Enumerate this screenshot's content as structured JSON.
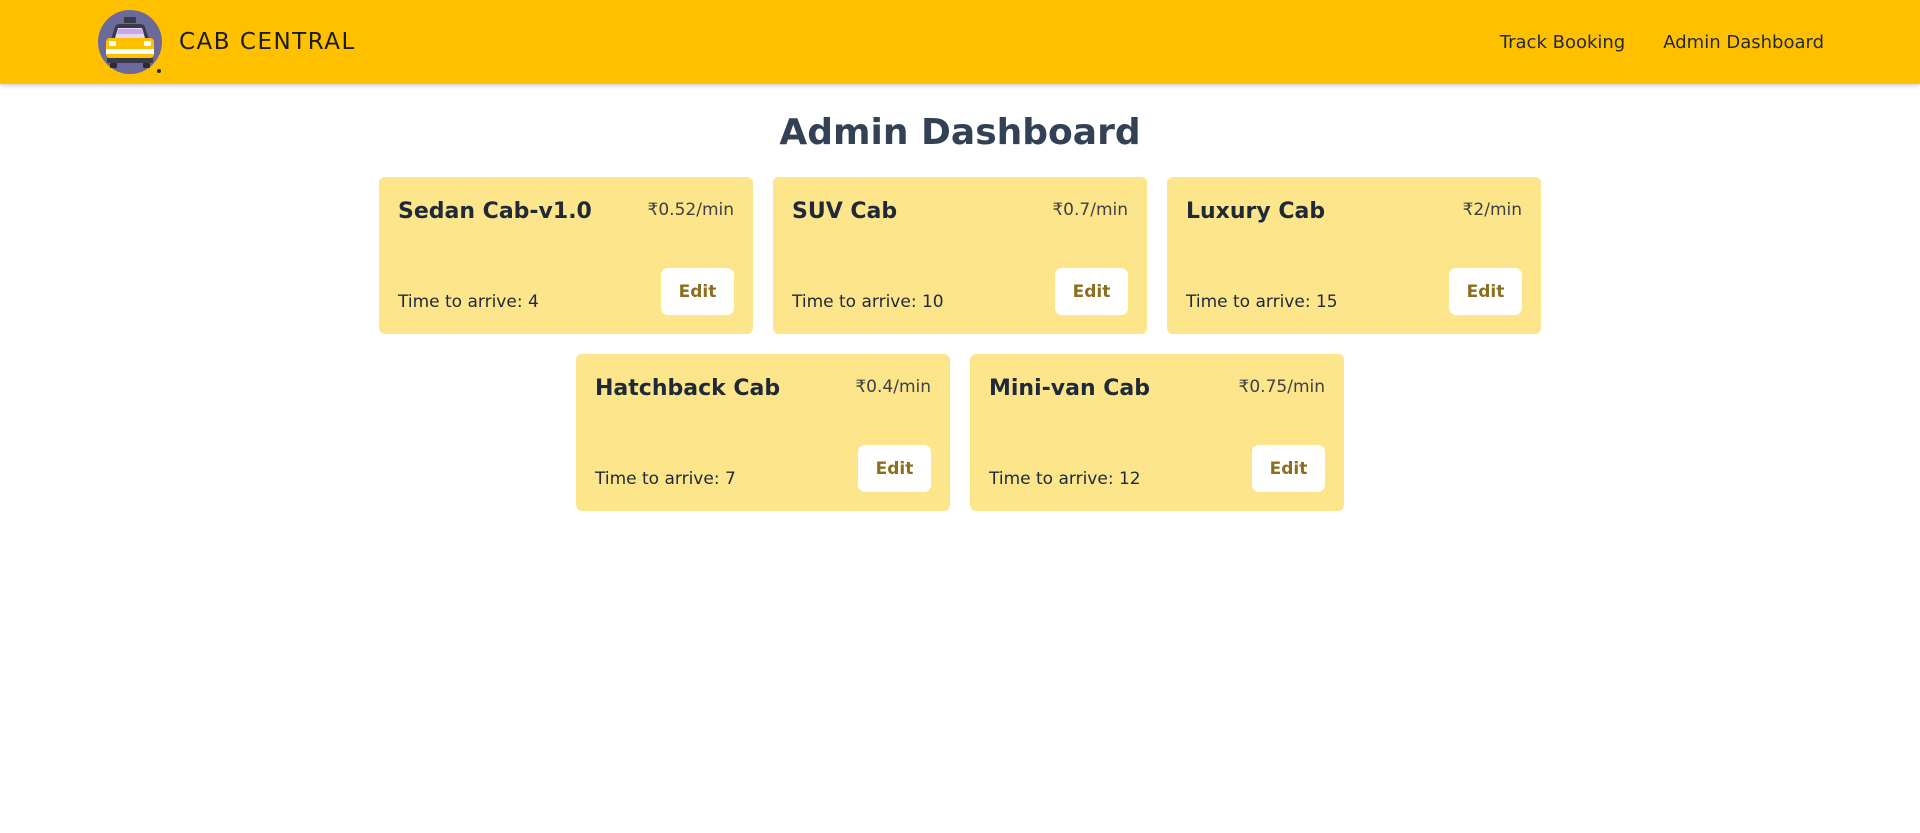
{
  "navbar": {
    "brand": "CAB CENTRAL",
    "logo_icon": "taxi-logo-icon",
    "links": [
      "Track Booking",
      "Admin Dashboard"
    ]
  },
  "page": {
    "title": "Admin Dashboard"
  },
  "colors": {
    "navbar": "#ffc000",
    "card": "#fce58b",
    "button_text": "#8b6f1e"
  },
  "cabs": [
    {
      "name": "Sedan Cab-v1.0",
      "rate": "₹0.52/min",
      "eta": "Time to arrive: 4",
      "action": "Edit"
    },
    {
      "name": "SUV Cab",
      "rate": "₹0.7/min",
      "eta": "Time to arrive: 10",
      "action": "Edit"
    },
    {
      "name": "Luxury Cab",
      "rate": "₹2/min",
      "eta": "Time to arrive: 15",
      "action": "Edit"
    },
    {
      "name": "Hatchback Cab",
      "rate": "₹0.4/min",
      "eta": "Time to arrive: 7",
      "action": "Edit"
    },
    {
      "name": "Mini-van Cab",
      "rate": "₹0.75/min",
      "eta": "Time to arrive: 12",
      "action": "Edit"
    }
  ]
}
